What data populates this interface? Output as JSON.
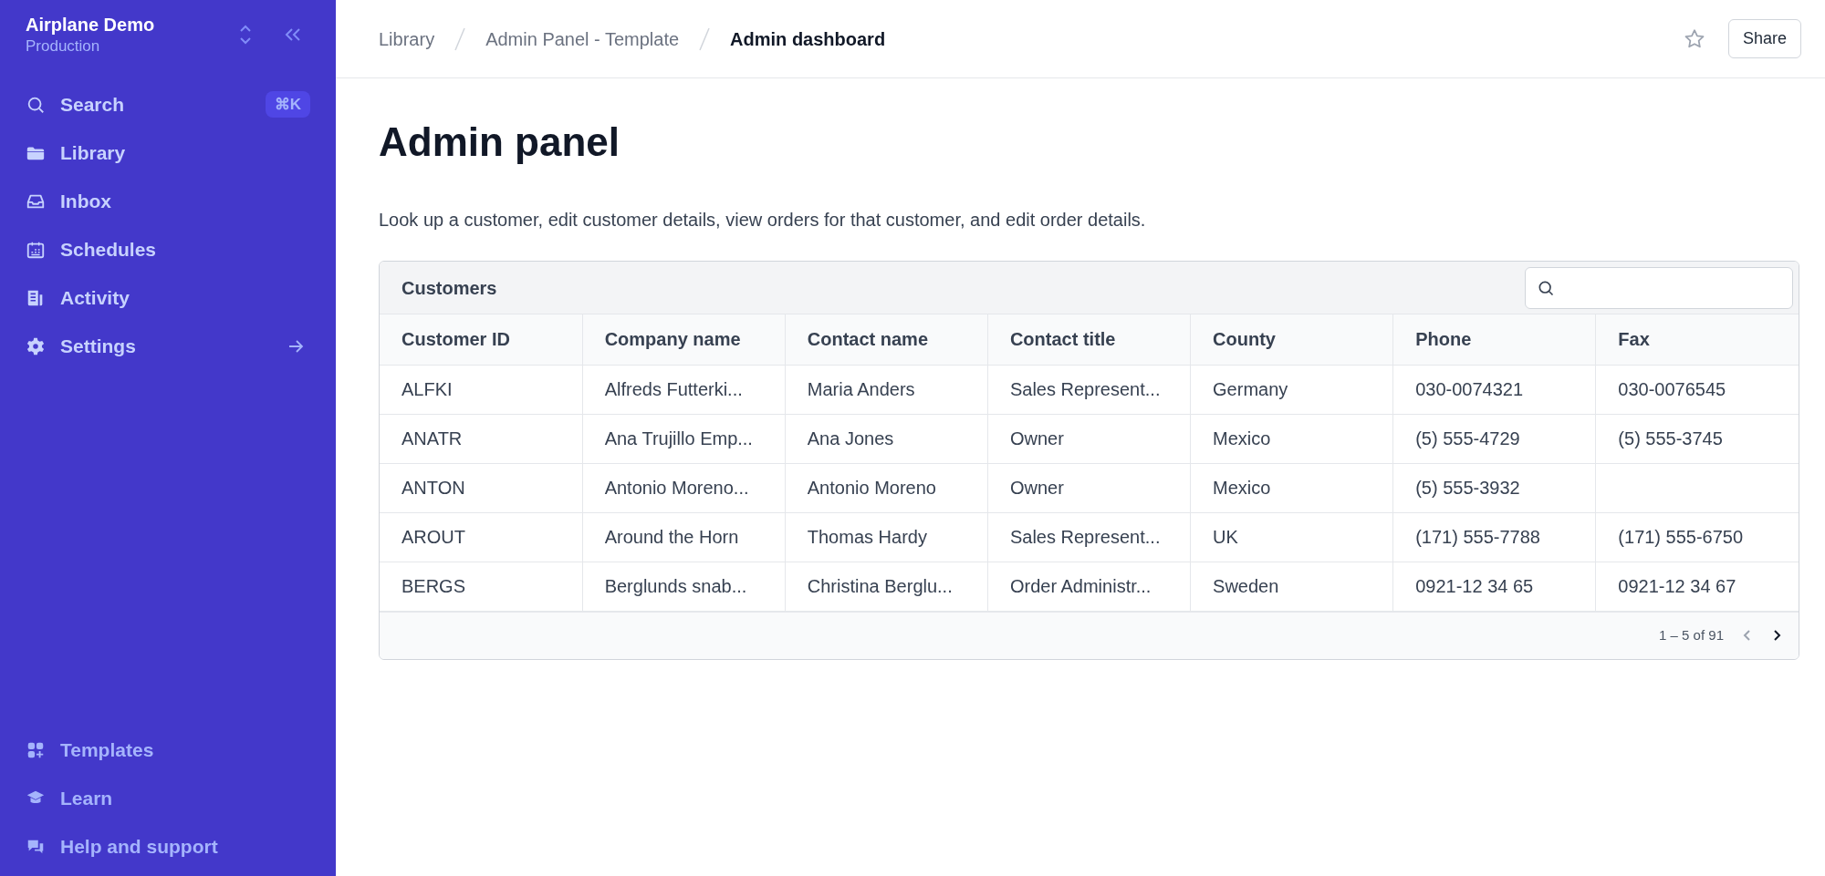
{
  "workspace": {
    "name": "Airplane Demo",
    "environment": "Production"
  },
  "sidebar": {
    "items": [
      {
        "kind": "search",
        "label": "Search",
        "shortcut": "⌘K"
      },
      {
        "kind": "library",
        "label": "Library"
      },
      {
        "kind": "inbox",
        "label": "Inbox"
      },
      {
        "kind": "schedules",
        "label": "Schedules"
      },
      {
        "kind": "activity",
        "label": "Activity"
      },
      {
        "kind": "settings",
        "label": "Settings"
      }
    ],
    "bottom_items": [
      {
        "kind": "templates",
        "label": "Templates"
      },
      {
        "kind": "learn",
        "label": "Learn"
      },
      {
        "kind": "help",
        "label": "Help and support"
      }
    ]
  },
  "breadcrumbs": [
    {
      "label": "Library",
      "current": false
    },
    {
      "label": "Admin Panel - Template",
      "current": false
    },
    {
      "label": "Admin dashboard",
      "current": true
    }
  ],
  "header_actions": {
    "share": "Share"
  },
  "page": {
    "title": "Admin panel",
    "description": "Look up a customer, edit customer details, view orders for that customer, and edit order details."
  },
  "table": {
    "title": "Customers",
    "columns": [
      "Customer ID",
      "Company name",
      "Contact name",
      "Contact title",
      "County",
      "Phone",
      "Fax"
    ],
    "rows": [
      [
        "ALFKI",
        "Alfreds Futterki...",
        "Maria Anders",
        "Sales Represent...",
        "Germany",
        "030-0074321",
        "030-0076545"
      ],
      [
        "ANATR",
        "Ana Trujillo Emp...",
        "Ana Jones",
        "Owner",
        "Mexico",
        "(5) 555-4729",
        "(5) 555-3745"
      ],
      [
        "ANTON",
        "Antonio Moreno...",
        "Antonio Moreno",
        "Owner",
        "Mexico",
        "(5) 555-3932",
        ""
      ],
      [
        "AROUT",
        "Around the Horn",
        "Thomas Hardy",
        "Sales Represent...",
        "UK",
        "(171) 555-7788",
        "(171) 555-6750"
      ],
      [
        "BERGS",
        "Berglunds snab...",
        "Christina Berglu...",
        "Order Administr...",
        "Sweden",
        "0921-12 34 65",
        "0921-12 34 67"
      ]
    ],
    "pagination": {
      "range": "1 – 5 of 91",
      "prev_disabled": true,
      "next_disabled": false
    }
  }
}
